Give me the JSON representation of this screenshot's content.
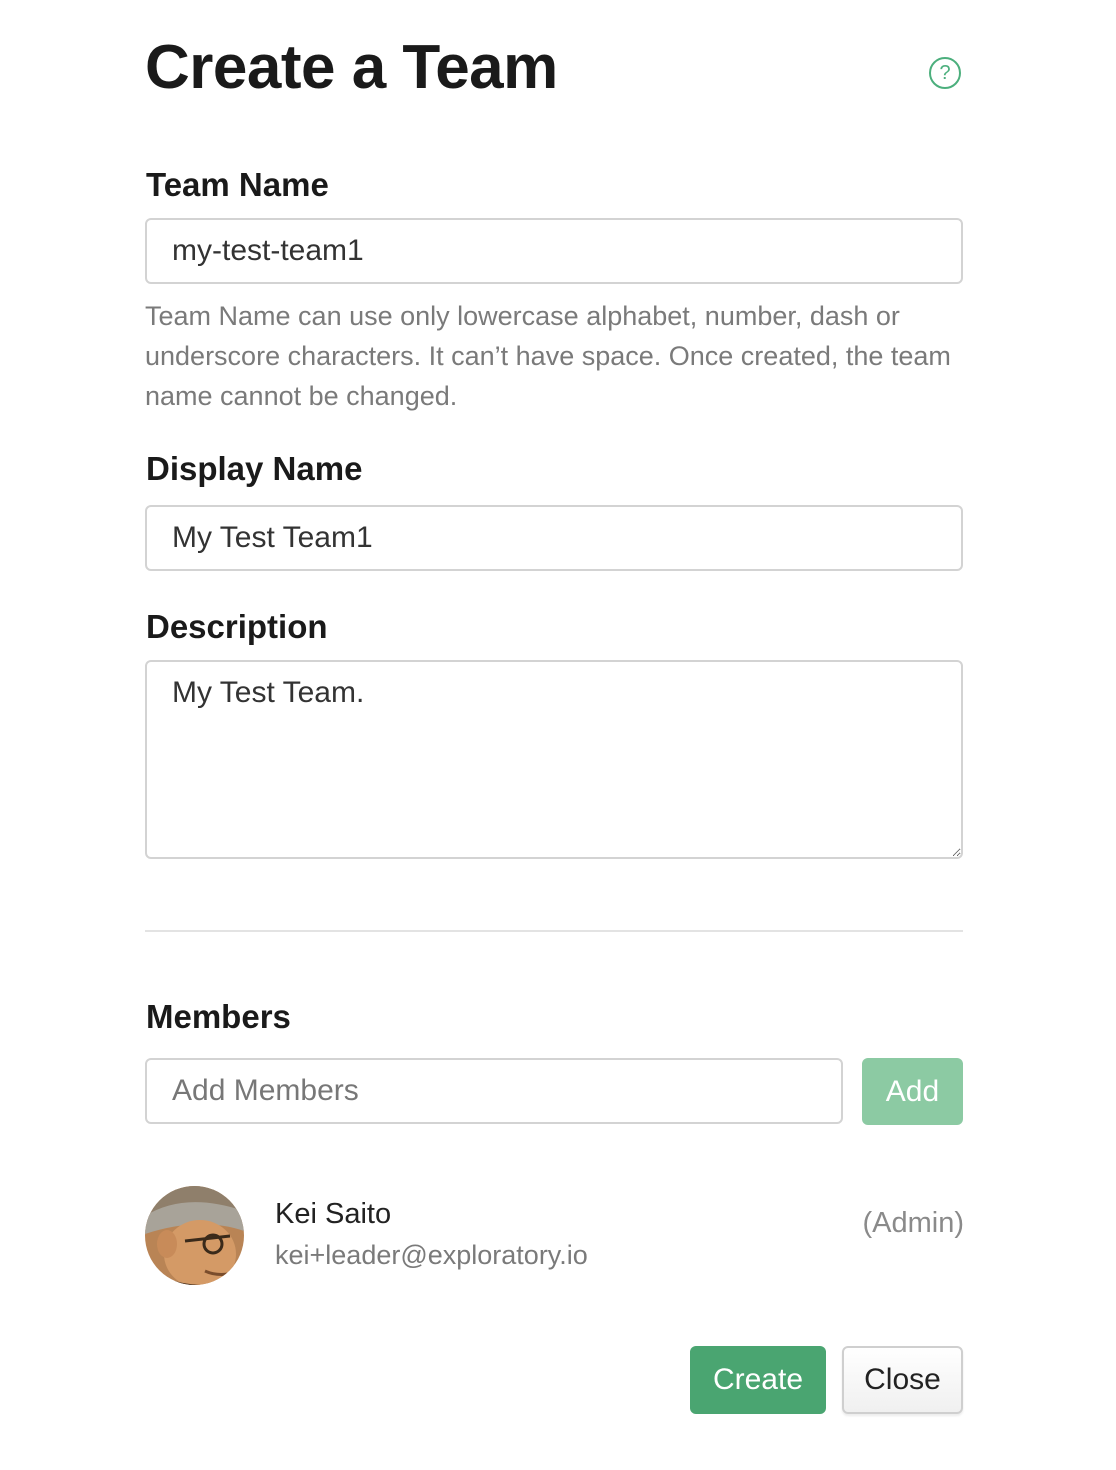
{
  "dialog": {
    "title": "Create a Team",
    "help_icon": "question-circle-icon"
  },
  "team_name": {
    "label": "Team Name",
    "value": "my-test-team1",
    "help": "Team Name can use only lowercase alphabet, number, dash or underscore characters. It can’t have space. Once created, the team name cannot be changed."
  },
  "display_name": {
    "label": "Display Name",
    "value": "My Test Team1"
  },
  "description": {
    "label": "Description",
    "value": "My Test Team."
  },
  "members": {
    "label": "Members",
    "input_placeholder": "Add Members",
    "add_label": "Add",
    "list": [
      {
        "name": "Kei Saito",
        "email": "kei+leader@exploratory.io",
        "role": "(Admin)",
        "avatar": "user-photo"
      }
    ]
  },
  "footer": {
    "create_label": "Create",
    "close_label": "Close"
  },
  "colors": {
    "accent": "#4aa571",
    "accent_disabled": "#8ccaa3",
    "help_text": "#7a7a7a",
    "border": "#d3d3d3"
  }
}
